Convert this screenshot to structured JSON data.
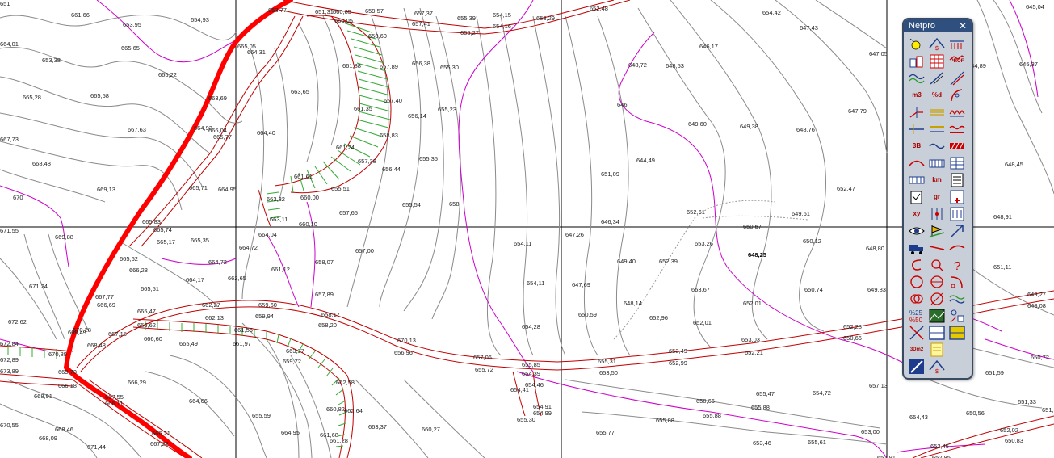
{
  "palette": {
    "title": "Netpro",
    "close_glyph": "✕",
    "tools": [
      {
        "icon": "sun-icon"
      },
      {
        "icon": "peak-s-icon"
      },
      {
        "icon": "fence-icon"
      },
      {
        "icon": "buildings-icon"
      },
      {
        "icon": "grid-icon"
      },
      {
        "icon": "profile-icon",
        "label": "PROF"
      },
      {
        "icon": "wave-icon"
      },
      {
        "icon": "slope-icon"
      },
      {
        "icon": "diagonal-icon"
      },
      {
        "icon": "volume-icon",
        "label": "m3"
      },
      {
        "icon": "diff-icon",
        "label": "%d"
      },
      {
        "icon": "curve-icon"
      },
      {
        "icon": "angle-icon"
      },
      {
        "icon": "parallel-icon"
      },
      {
        "icon": "zigzag-icon"
      },
      {
        "icon": "line-icon"
      },
      {
        "icon": "double-line-icon"
      },
      {
        "icon": "wavy-line-icon"
      },
      {
        "icon": "3d-icon",
        "label": "3B"
      },
      {
        "icon": "tilde-icon"
      },
      {
        "icon": "hatch-red-icon"
      },
      {
        "icon": "arc-icon"
      },
      {
        "icon": "rails-icon"
      },
      {
        "icon": "table-icon"
      },
      {
        "icon": "cells-icon"
      },
      {
        "icon": "km-icon",
        "label": "km"
      },
      {
        "icon": "list-icon"
      },
      {
        "icon": "sheet-icon"
      },
      {
        "icon": "gr-icon",
        "label": "gr"
      },
      {
        "icon": "calc-icon"
      },
      {
        "icon": "xy-km-icon",
        "label": "xy"
      },
      {
        "icon": "marker-icon"
      },
      {
        "icon": "pins-icon"
      },
      {
        "icon": "eye-icon"
      },
      {
        "icon": "flag-icon"
      },
      {
        "icon": "arrow-icon"
      },
      {
        "icon": "truck-icon"
      },
      {
        "icon": "road-icon"
      },
      {
        "icon": "curve2-icon"
      },
      {
        "icon": "hook-icon"
      },
      {
        "icon": "lens-icon"
      },
      {
        "icon": "question-icon"
      },
      {
        "icon": "circle-icon"
      },
      {
        "icon": "target-icon"
      },
      {
        "icon": "bend-icon"
      },
      {
        "icon": "rings-icon"
      },
      {
        "icon": "circle2-icon"
      },
      {
        "icon": "green-wave-icon"
      },
      {
        "icon": "percent-icon"
      },
      {
        "icon": "image-icon"
      },
      {
        "icon": "pattern-icon"
      },
      {
        "icon": "cross-icon"
      },
      {
        "icon": "frame-icon"
      },
      {
        "icon": "frame2-icon"
      },
      {
        "icon": "area-icon",
        "label": "3Dm2"
      },
      {
        "icon": "notes-icon"
      },
      {
        "icon": "blank-icon"
      },
      {
        "icon": "select-icon"
      },
      {
        "icon": "peak2-icon"
      }
    ]
  },
  "map": {
    "contour_color": "#808080",
    "index_contour_color": "#cc00cc",
    "road_color": "#c00000",
    "highlight_color": "#ff0000",
    "hatch_color": "#33aa33",
    "labels": [
      {
        "t": "661,66"
      },
      {
        "t": "653,95"
      },
      {
        "t": "654,93"
      },
      {
        "t": "653,38"
      },
      {
        "t": "665,22"
      },
      {
        "t": "665,28"
      },
      {
        "t": "665,58"
      },
      {
        "t": "665,65"
      },
      {
        "t": "667,63"
      },
      {
        "t": "667,73"
      },
      {
        "t": "668,48"
      },
      {
        "t": "669,13"
      },
      {
        "t": "670"
      },
      {
        "t": "671,55"
      },
      {
        "t": "669,88"
      },
      {
        "t": "671,24"
      },
      {
        "t": "672,62"
      },
      {
        "t": "672,84"
      },
      {
        "t": "672,89"
      },
      {
        "t": "673,89"
      },
      {
        "t": "668,91"
      },
      {
        "t": "668,46"
      },
      {
        "t": "668,09"
      },
      {
        "t": "671,44"
      },
      {
        "t": "670,55"
      },
      {
        "t": "664,01"
      },
      {
        "t": "653,77"
      },
      {
        "t": "651,31"
      },
      {
        "t": "660,85"
      },
      {
        "t": "659,57"
      },
      {
        "t": "657,37"
      },
      {
        "t": "657,41"
      },
      {
        "t": "655,39"
      },
      {
        "t": "654,15"
      },
      {
        "t": "654,16"
      },
      {
        "t": "653,29"
      },
      {
        "t": "652,48"
      },
      {
        "t": "655,27"
      },
      {
        "t": "660,05"
      },
      {
        "t": "658,60"
      },
      {
        "t": "661,88"
      },
      {
        "t": "657,89"
      },
      {
        "t": "656,38"
      },
      {
        "t": "655,30"
      },
      {
        "t": "655,23"
      },
      {
        "t": "661,35"
      },
      {
        "t": "657,40"
      },
      {
        "t": "656,14"
      },
      {
        "t": "658,83"
      },
      {
        "t": "661,24"
      },
      {
        "t": "657,38"
      },
      {
        "t": "655,35"
      },
      {
        "t": "656,44"
      },
      {
        "t": "661,61"
      },
      {
        "t": "655,51"
      },
      {
        "t": "660,00"
      },
      {
        "t": "657,65"
      },
      {
        "t": "655,54"
      },
      {
        "t": "658"
      },
      {
        "t": "657,00"
      },
      {
        "t": "654,11"
      },
      {
        "t": "654,11"
      },
      {
        "t": "654,28"
      },
      {
        "t": "663,65"
      },
      {
        "t": "664,40"
      },
      {
        "t": "664,31"
      },
      {
        "t": "665,05"
      },
      {
        "t": "663,69"
      },
      {
        "t": "666,04"
      },
      {
        "t": "665,77"
      },
      {
        "t": "664,93"
      },
      {
        "t": "664,95"
      },
      {
        "t": "665,71"
      },
      {
        "t": "665,83"
      },
      {
        "t": "665,74"
      },
      {
        "t": "665,17"
      },
      {
        "t": "665,35"
      },
      {
        "t": "664,72"
      },
      {
        "t": "664,72"
      },
      {
        "t": "664,17"
      },
      {
        "t": "662,65"
      },
      {
        "t": "661,12"
      },
      {
        "t": "665,62"
      },
      {
        "t": "666,28"
      },
      {
        "t": "665,51"
      },
      {
        "t": "667,77"
      },
      {
        "t": "666,69"
      },
      {
        "t": "665,47"
      },
      {
        "t": "665,62"
      },
      {
        "t": "666,60"
      },
      {
        "t": "665,49"
      },
      {
        "t": "667,15"
      },
      {
        "t": "668,48"
      },
      {
        "t": "668,49"
      },
      {
        "t": "663,32"
      },
      {
        "t": "663,11"
      },
      {
        "t": "660,10"
      },
      {
        "t": "664,04"
      },
      {
        "t": "658,07"
      },
      {
        "t": "657,89"
      },
      {
        "t": "659,60"
      },
      {
        "t": "662,27"
      },
      {
        "t": "662,13"
      },
      {
        "t": "659,94"
      },
      {
        "t": "658,17"
      },
      {
        "t": "658,20"
      },
      {
        "t": "661,55"
      },
      {
        "t": "661,97"
      },
      {
        "t": "663,77"
      },
      {
        "t": "659,72"
      },
      {
        "t": "662,58"
      },
      {
        "t": "660,82"
      },
      {
        "t": "662,64"
      },
      {
        "t": "661,28"
      },
      {
        "t": "661,68"
      },
      {
        "t": "663,37"
      },
      {
        "t": "660,27"
      },
      {
        "t": "655,59"
      },
      {
        "t": "664,95"
      },
      {
        "t": "664,66"
      },
      {
        "t": "666,29"
      },
      {
        "t": "667,55"
      },
      {
        "t": "666,11"
      },
      {
        "t": "666,21"
      },
      {
        "t": "667,22"
      },
      {
        "t": "666,18"
      },
      {
        "t": "669,70"
      },
      {
        "t": "670,28"
      },
      {
        "t": "670,89"
      },
      {
        "t": "670,13"
      },
      {
        "t": "656,96"
      },
      {
        "t": "657,06"
      },
      {
        "t": "655,72"
      },
      {
        "t": "655,85"
      },
      {
        "t": "654,39"
      },
      {
        "t": "654,46"
      },
      {
        "t": "654,41"
      },
      {
        "t": "654,91"
      },
      {
        "t": "654,99"
      },
      {
        "t": "655,30"
      },
      {
        "t": "655,31"
      },
      {
        "t": "653,50"
      },
      {
        "t": "653,49"
      },
      {
        "t": "652,99"
      },
      {
        "t": "653,03"
      },
      {
        "t": "652,21"
      },
      {
        "t": "652,28"
      },
      {
        "t": "650,66"
      },
      {
        "t": "650,66"
      },
      {
        "t": "655,88"
      },
      {
        "t": "655,88"
      },
      {
        "t": "655,77"
      },
      {
        "t": "655,88"
      },
      {
        "t": "655,47"
      },
      {
        "t": "654,72"
      },
      {
        "t": "653,46"
      },
      {
        "t": "655,61"
      },
      {
        "t": "655,45"
      },
      {
        "t": "656,09"
      },
      {
        "t": "657,13"
      },
      {
        "t": "653,00"
      },
      {
        "t": "654,43"
      },
      {
        "t": "653,45"
      },
      {
        "t": "652,85"
      },
      {
        "t": "652,91"
      },
      {
        "t": "654,42"
      },
      {
        "t": "647,43"
      },
      {
        "t": "646,17"
      },
      {
        "t": "648,53"
      },
      {
        "t": "648,72"
      },
      {
        "t": "646"
      },
      {
        "t": "649,60"
      },
      {
        "t": "649,38"
      },
      {
        "t": "648,76"
      },
      {
        "t": "647,79"
      },
      {
        "t": "647,05"
      },
      {
        "t": "644,89"
      },
      {
        "t": "645,37"
      },
      {
        "t": "645,04"
      },
      {
        "t": "644,49"
      },
      {
        "t": "651,09"
      },
      {
        "t": "652,47"
      },
      {
        "t": "648,45"
      },
      {
        "t": "646,34"
      },
      {
        "t": "652,61"
      },
      {
        "t": "650,57"
      },
      {
        "t": "649,61"
      },
      {
        "t": "648,91"
      },
      {
        "t": "647,26"
      },
      {
        "t": "653,26"
      },
      {
        "t": "650,12"
      },
      {
        "t": "648,80"
      },
      {
        "t": "648,25"
      },
      {
        "t": "649,40"
      },
      {
        "t": "652,39"
      },
      {
        "t": "651,11"
      },
      {
        "t": "647,69"
      },
      {
        "t": "653,67"
      },
      {
        "t": "650,74"
      },
      {
        "t": "649,83"
      },
      {
        "t": "649,27"
      },
      {
        "t": "648,08"
      },
      {
        "t": "648,14"
      },
      {
        "t": "652,01"
      },
      {
        "t": "650,59"
      },
      {
        "t": "652,96"
      },
      {
        "t": "652,01"
      },
      {
        "t": "651,59"
      },
      {
        "t": "651,33"
      },
      {
        "t": "650,56"
      },
      {
        "t": "652,02"
      },
      {
        "t": "650,83"
      },
      {
        "t": "650,72"
      },
      {
        "t": "651,15"
      },
      {
        "t": "651"
      }
    ]
  }
}
